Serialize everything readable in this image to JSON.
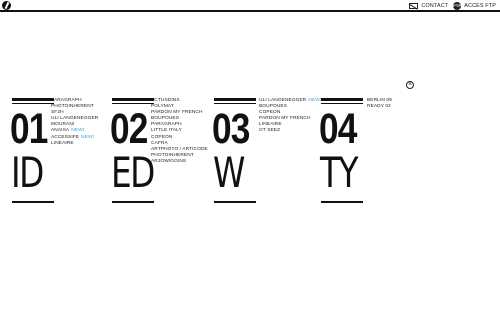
{
  "header": {
    "contact_label": "CONTACT",
    "ftp_label": "ACCES FTP",
    "ftp_icon_text": "FTP"
  },
  "close_symbol": "×",
  "accent_color": "#3aa0d8",
  "sections": [
    {
      "number": "01",
      "word": "ID",
      "items": [
        {
          "label": "PARAGRAPH",
          "new": ""
        },
        {
          "label": "PHOTOINHERENT",
          "new": ""
        },
        {
          "label": "SF2H",
          "new": ""
        },
        {
          "label": "ULI LANGENEGGER",
          "new": ""
        },
        {
          "label": "MOURANI",
          "new": ""
        },
        {
          "label": "ANAISA",
          "new": "NEW!"
        },
        {
          "label": "ACCESSIFE",
          "new": "NEW!"
        },
        {
          "label": "LINEAIRE",
          "new": ""
        }
      ]
    },
    {
      "number": "02",
      "word": "ED",
      "items": [
        {
          "label": "ACTUSDINS",
          "new": ""
        },
        {
          "label": "POLYMAT",
          "new": ""
        },
        {
          "label": "PARDON MY FRENCH",
          "new": ""
        },
        {
          "label": "BOUPOUES",
          "new": ""
        },
        {
          "label": "PARAGRAPH",
          "new": ""
        },
        {
          "label": "LITTLE ITALY",
          "new": ""
        },
        {
          "label": "COPEON",
          "new": ""
        },
        {
          "label": "CAFRA",
          "new": ""
        },
        {
          "label": "ARTPHOTO / ARTICODE",
          "new": ""
        },
        {
          "label": "PHOTOINHERENT",
          "new": ""
        },
        {
          "label": "ARJOWIGGINS",
          "new": ""
        }
      ]
    },
    {
      "number": "03",
      "word": "W",
      "items": [
        {
          "label": "ULI LANGENEGGER",
          "new": "NEW!"
        },
        {
          "label": "BOUPOUES",
          "new": ""
        },
        {
          "label": "COPEON",
          "new": ""
        },
        {
          "label": "PARDON MY FRENCH",
          "new": ""
        },
        {
          "label": "LINEAIRE",
          "new": ""
        },
        {
          "label": "OT SEEZ",
          "new": ""
        }
      ]
    },
    {
      "number": "04",
      "word": "TY",
      "items": [
        {
          "label": "BERLIN 09",
          "new": ""
        },
        {
          "label": "READY 02",
          "new": ""
        }
      ]
    }
  ]
}
